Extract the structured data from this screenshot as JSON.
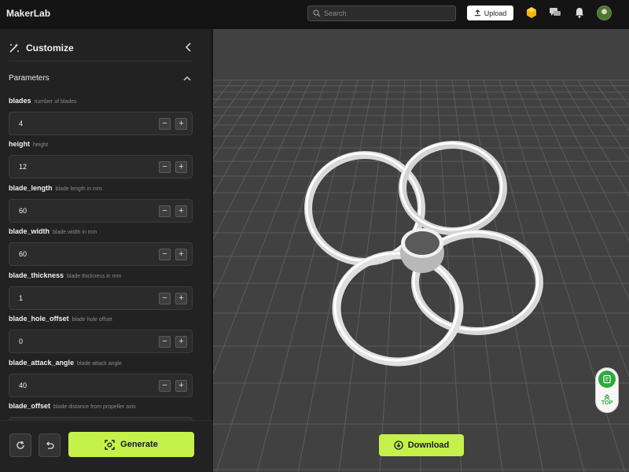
{
  "app": {
    "title": "MakerLab"
  },
  "header": {
    "search_placeholder": "Search",
    "upload_label": "Upload"
  },
  "sidebar": {
    "title": "Customize",
    "section_title": "Parameters",
    "params": [
      {
        "name": "blades",
        "desc": "number of blades",
        "value": "4"
      },
      {
        "name": "height",
        "desc": "height",
        "value": "12"
      },
      {
        "name": "blade_length",
        "desc": "blade length in mm",
        "value": "60"
      },
      {
        "name": "blade_width",
        "desc": "blade width in mm",
        "value": "60"
      },
      {
        "name": "blade_thickness",
        "desc": "blade thickness in mm",
        "value": "1"
      },
      {
        "name": "blade_hole_offset",
        "desc": "blade hole offset",
        "value": "0"
      },
      {
        "name": "blade_attack_angle",
        "desc": "blade attack angle",
        "value": "40"
      },
      {
        "name": "blade_offset",
        "desc": "blade distance from propeller axis",
        "value": ""
      }
    ],
    "generate_label": "Generate"
  },
  "viewport": {
    "download_label": "Download",
    "top_label": "TOP"
  },
  "colors": {
    "accent": "#c4f24a",
    "badge_green": "#2eaa3a"
  }
}
